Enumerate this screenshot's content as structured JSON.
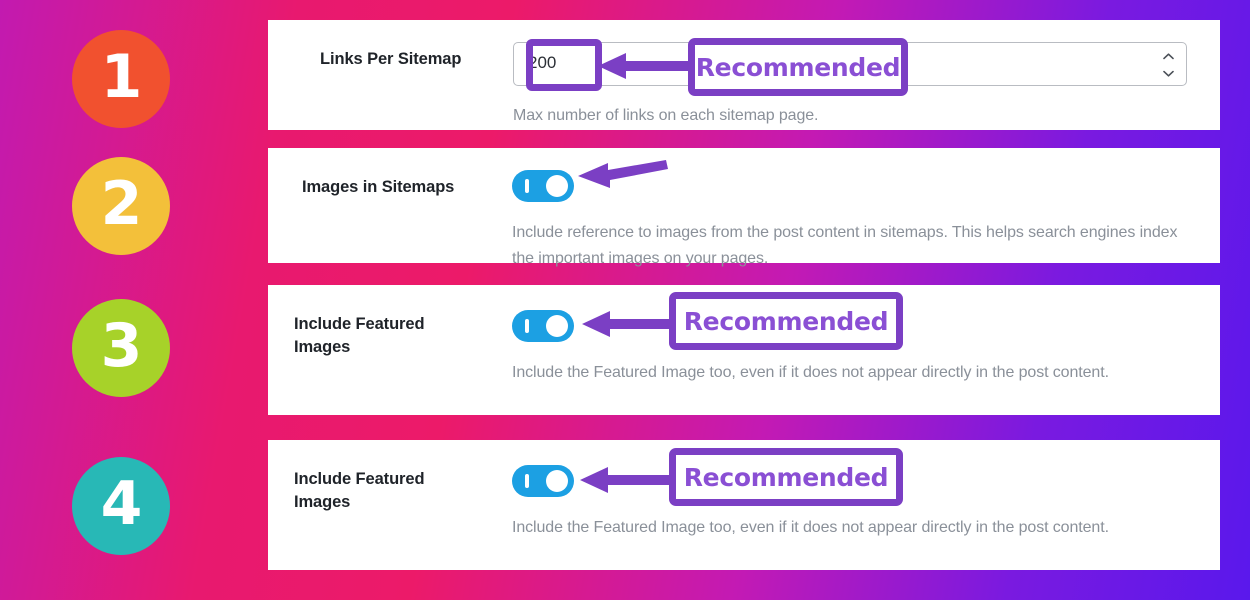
{
  "background": {
    "gradient_start": "#c21ab0",
    "gradient_mid": "#ec1a69",
    "gradient_end": "#5a18ec"
  },
  "steps": [
    {
      "number": "1",
      "color": "#f1512f"
    },
    {
      "number": "2",
      "color": "#f3c03a"
    },
    {
      "number": "3",
      "color": "#a7d229"
    },
    {
      "number": "4",
      "color": "#28b8b6"
    }
  ],
  "annotation": {
    "badge_label": "Recommended",
    "badge_text_color": "#8a4fd4",
    "badge_border_color": "#7b3fc4",
    "arrow_color": "#7b3fc4"
  },
  "settings": [
    {
      "id": "links-per-sitemap",
      "label": "Links Per Sitemap",
      "control": "number",
      "value": "200",
      "helper": "Max number of links on each sitemap page.",
      "recommended": true
    },
    {
      "id": "images-in-sitemaps",
      "label": "Images in Sitemaps",
      "control": "toggle",
      "toggle_state": "on",
      "toggle_color": "#1ca0e3",
      "helper": "Include reference to images from the post content in sitemaps. This helps search engines index the important images on your pages.",
      "recommended": false
    },
    {
      "id": "include-featured-images",
      "label": "Include Featured Images",
      "control": "toggle",
      "toggle_state": "on",
      "toggle_color": "#1ca0e3",
      "helper": "Include the Featured Image too, even if it does not appear directly in the post content.",
      "recommended": true
    },
    {
      "id": "include-featured-images-2",
      "label": "Include Featured Images",
      "control": "toggle",
      "toggle_state": "on",
      "toggle_color": "#1ca0e3",
      "helper": "Include the Featured Image too, even if it does not appear directly in the post content.",
      "recommended": true
    }
  ]
}
